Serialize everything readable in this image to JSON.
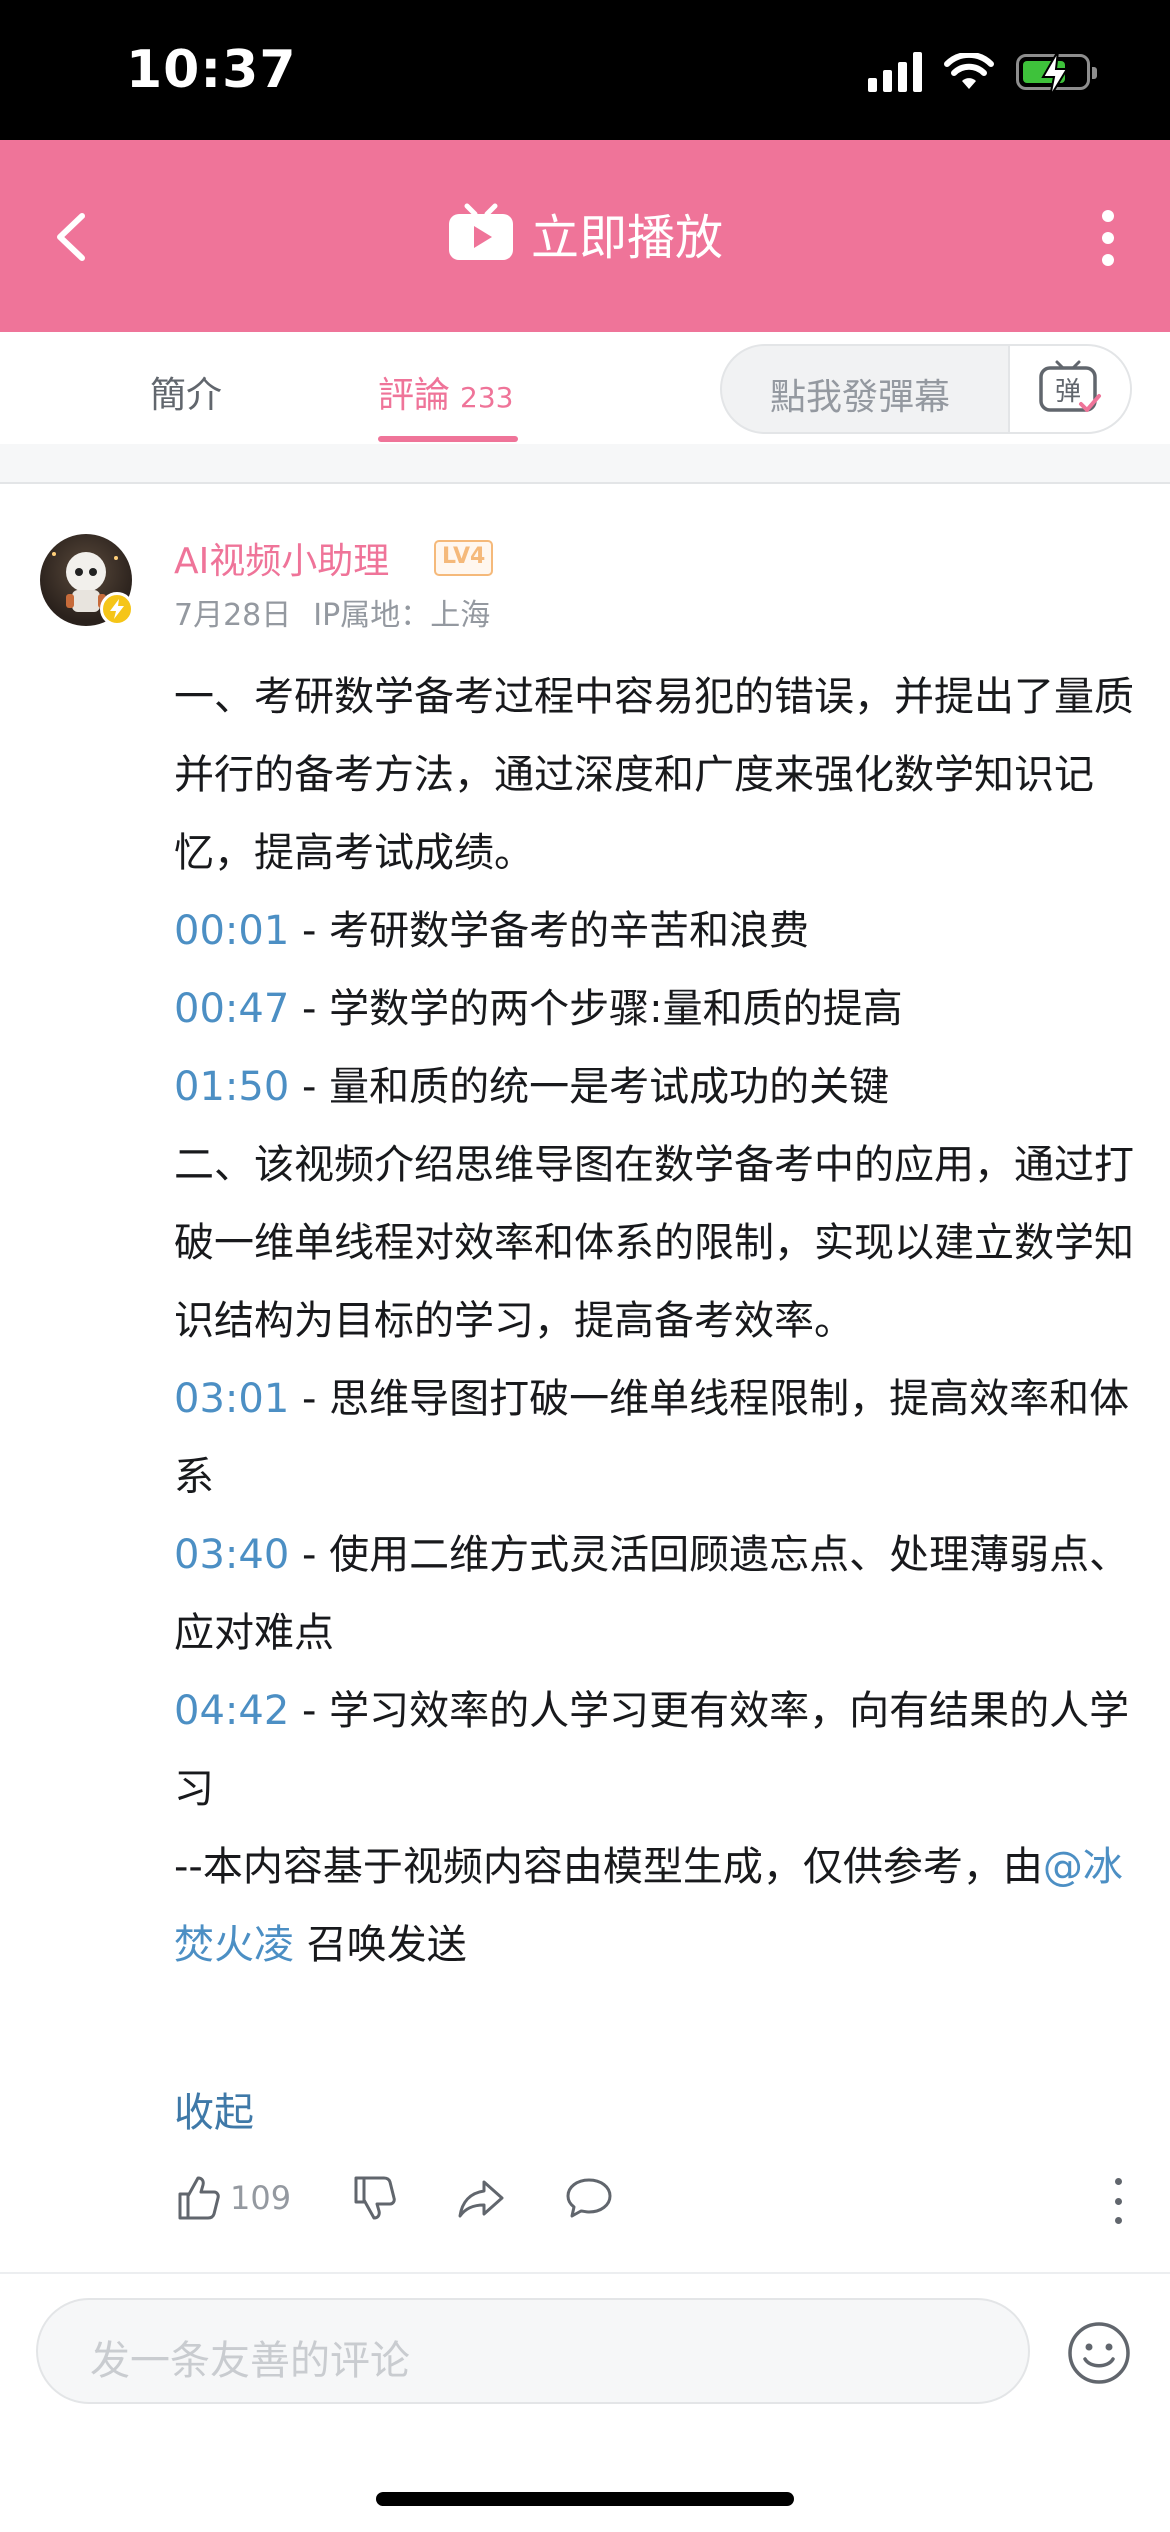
{
  "status_bar": {
    "time": "10:37"
  },
  "header": {
    "title": "立即播放"
  },
  "tabs": {
    "intro_label": "簡介",
    "comments_label": "評論",
    "comments_count": "233",
    "danmaku_placeholder": "點我發彈幕",
    "danmaku_icon_text": "弹"
  },
  "comment": {
    "user_name": "AI视频小助理",
    "level": "LV4",
    "date": "7月28日",
    "ip_location": "IP属地：上海",
    "lines": [
      {
        "ts": "",
        "text": "一、考研数学备考过程中容易犯的错误，并提出了量质并行的备考方法，通过深度和广度来强化数学知识记忆，提高考试成绩。"
      },
      {
        "ts": "00:01",
        "text": " - 考研数学备考的辛苦和浪费"
      },
      {
        "ts": "00:47",
        "text": " - 学数学的两个步骤:量和质的提高"
      },
      {
        "ts": "01:50",
        "text": " - 量和质的统一是考试成功的关键"
      },
      {
        "ts": "",
        "text": "二、该视频介绍思维导图在数学备考中的应用，通过打破一维单线程对效率和体系的限制，实现以建立数学知识结构为目标的学习，提高备考效率。"
      },
      {
        "ts": "03:01",
        "text": " - 思维导图打破一维单线程限制，提高效率和体系"
      },
      {
        "ts": "03:40",
        "text": " - 使用二维方式灵活回顾遗忘点、处理薄弱点、应对难点"
      },
      {
        "ts": "04:42",
        "text": " - 学习效率的人学习更有效率，向有结果的人学习"
      }
    ],
    "footer_prefix": "--本内容基于视频内容由模型生成，仅供参考，由",
    "mention": "@冰焚火凌",
    "footer_suffix": " 召唤发送",
    "collapse_label": "收起",
    "like_count": "109"
  },
  "bottom": {
    "input_placeholder": "发一条友善的评论"
  },
  "colors": {
    "brand_pink": "#ef7499",
    "timestamp_blue": "#4c8fc4",
    "level_orange": "#f5b97a"
  },
  "icons": [
    "back-icon",
    "tv-play-icon",
    "more-vertical-icon",
    "danmaku-toggle-icon",
    "thumb-up-icon",
    "thumb-down-icon",
    "share-icon",
    "reply-icon",
    "emoji-icon"
  ]
}
